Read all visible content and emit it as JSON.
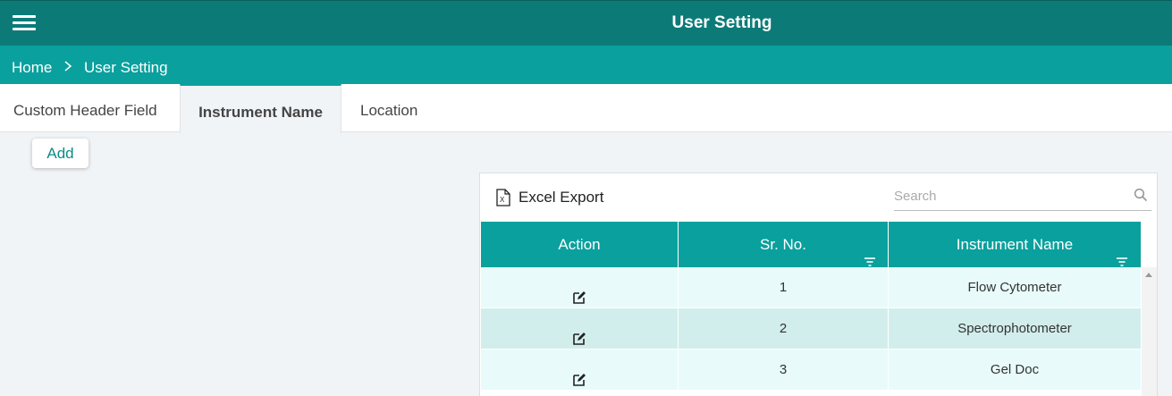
{
  "header": {
    "title": "User Setting",
    "menu_icon": "hamburger-menu-icon"
  },
  "breadcrumb": {
    "home": "Home",
    "separator": ">",
    "current": "User Setting"
  },
  "tabs": [
    {
      "label": "Custom Header Field",
      "active": false
    },
    {
      "label": "Instrument Name",
      "active": true
    },
    {
      "label": "Location",
      "active": false
    }
  ],
  "add_button": {
    "label": "Add"
  },
  "grid": {
    "toolbar": {
      "excel_export_label": "Excel Export",
      "excel_icon": "excel-file-icon"
    },
    "search": {
      "placeholder": "Search",
      "value": ""
    },
    "columns": [
      {
        "label": "Action",
        "filterable": false
      },
      {
        "label": "Sr. No.",
        "filterable": true
      },
      {
        "label": "Instrument Name",
        "filterable": true
      }
    ],
    "rows": [
      {
        "sr_no": "1",
        "instrument_name": "Flow Cytometer",
        "action_icon": "edit-icon"
      },
      {
        "sr_no": "2",
        "instrument_name": "Spectrophotometer",
        "action_icon": "edit-icon"
      },
      {
        "sr_no": "3",
        "instrument_name": "Gel Doc",
        "action_icon": "edit-icon"
      }
    ]
  },
  "colors": {
    "topbar": "#0c7b78",
    "breadcrumb_bar": "#0aa09d",
    "table_header": "#0aa09d",
    "row_odd": "#e8fbfa",
    "row_even": "#d2eeec",
    "accent_text": "#0c8a87"
  }
}
